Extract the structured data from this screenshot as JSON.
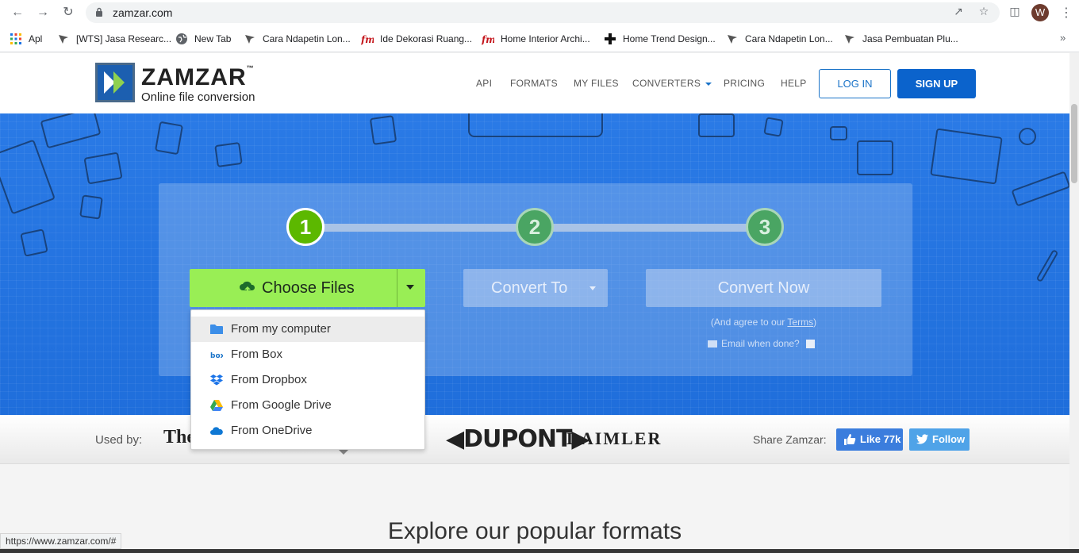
{
  "browser": {
    "url": "zamzar.com",
    "status_url": "https://www.zamzar.com/#",
    "avatar_letter": "W",
    "bookmarks": [
      {
        "label": "Apl",
        "icon": "apps-grid-icon"
      },
      {
        "label": "[WTS] Jasa Researc...",
        "icon": "bookmark-icon"
      },
      {
        "label": "New Tab",
        "icon": "globe-icon"
      },
      {
        "label": "Cara Ndapetin Lon...",
        "icon": "bookmark-icon"
      },
      {
        "label": "Ide Dekorasi Ruang...",
        "icon": "fm-icon"
      },
      {
        "label": "Home Interior Archi...",
        "icon": "fm-icon"
      },
      {
        "label": "Home Trend Design...",
        "icon": "cross-icon"
      },
      {
        "label": "Cara Ndapetin Lon...",
        "icon": "bookmark-icon"
      },
      {
        "label": "Jasa Pembuatan Plu...",
        "icon": "bookmark-icon"
      }
    ],
    "more_bookmarks": "»"
  },
  "header": {
    "brand": "ZAMZAR",
    "tm": "™",
    "tagline": "Online file conversion",
    "nav": [
      "API",
      "FORMATS",
      "MY FILES",
      "CONVERTERS",
      "PRICING",
      "HELP"
    ],
    "login": "LOG IN",
    "signup": "SIGN UP"
  },
  "converter": {
    "steps": [
      "1",
      "2",
      "3"
    ],
    "choose_files": "Choose Files",
    "convert_to": "Convert To",
    "convert_now": "Convert Now",
    "agree_prefix": "(And agree to our ",
    "terms": "Terms",
    "agree_suffix": ")",
    "email_when_done": "Email when done?"
  },
  "dropdown": {
    "items": [
      {
        "label": "From my computer",
        "icon": "folder-icon"
      },
      {
        "label": "From Box",
        "icon": "box-icon"
      },
      {
        "label": "From Dropbox",
        "icon": "dropbox-icon"
      },
      {
        "label": "From Google Drive",
        "icon": "google-drive-icon"
      },
      {
        "label": "From OneDrive",
        "icon": "onedrive-icon"
      }
    ]
  },
  "usedby": {
    "label": "Used by:",
    "logos": [
      "The",
      "DUPONT",
      "DAIMLER"
    ],
    "share_label": "Share Zamzar:",
    "facebook": "Like 77k",
    "twitter": "Follow"
  },
  "lower": {
    "heading": "Explore our popular formats"
  },
  "colors": {
    "hero_blue": "#2a7ae6",
    "choose_green": "#99ee55",
    "step_active": "#5cb800",
    "signup_blue": "#0b63cc"
  }
}
